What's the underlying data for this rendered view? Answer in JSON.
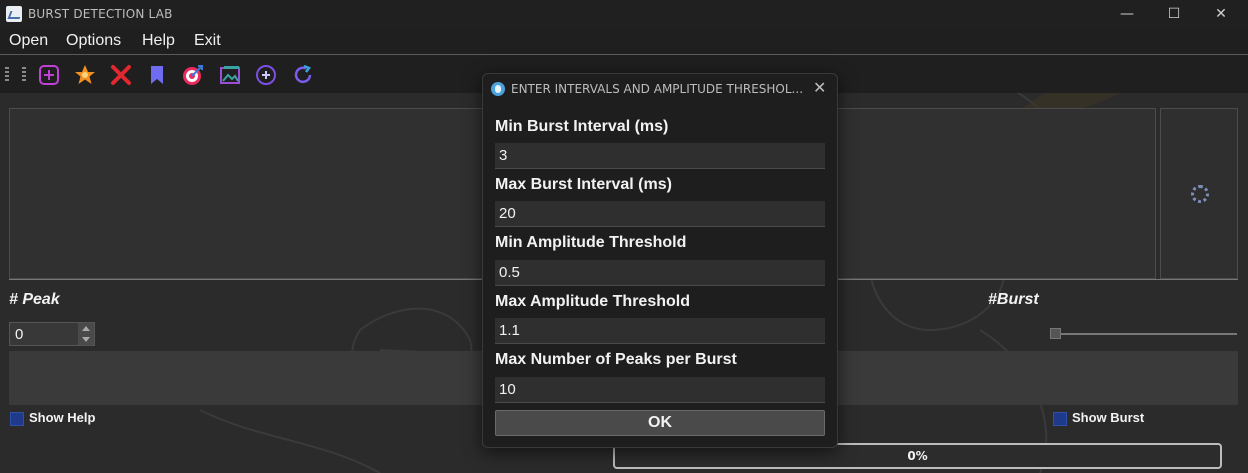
{
  "window": {
    "title": "BURST DETECTION LAB",
    "minimize": "—",
    "maximize": "☐",
    "close": "✕"
  },
  "menu": [
    "Open",
    "Options",
    "Help",
    "Exit"
  ],
  "toolbar": {
    "icons": [
      "add-icon",
      "star-icon",
      "delete-icon",
      "bookmark-icon",
      "target-icon",
      "image-icon",
      "zoom-in-icon",
      "refresh-icon"
    ]
  },
  "main": {
    "peak_label": "# Peak",
    "peak_value": "0",
    "burst_label": "#Burst",
    "show_help": "Show Help",
    "show_burst": "Show Burst",
    "progress_text": "0%",
    "progress_value": 0
  },
  "dialog": {
    "title": "ENTER INTERVALS AND AMPLITUDE THRESHOL...",
    "close": "✕",
    "fields": [
      {
        "label": "Min Burst Interval (ms)",
        "value": "3"
      },
      {
        "label": "Max Burst Interval (ms)",
        "value": "20"
      },
      {
        "label": "Min Amplitude Threshold",
        "value": "0.5"
      },
      {
        "label": "Max Amplitude Threshold",
        "value": "1.1"
      },
      {
        "label": "Max Number of Peaks per Burst",
        "value": "10"
      }
    ],
    "ok": "OK"
  },
  "colors": {
    "accent": "#3b6fd6",
    "checkbox": "#1f3a8a"
  }
}
